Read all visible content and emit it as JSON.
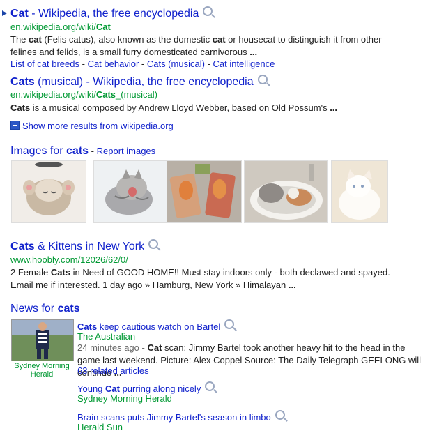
{
  "results": [
    {
      "title_pre": "Cat",
      "title_post": " - Wikipedia, the free encyclopedia",
      "url_pre": "en.wikipedia.org/wiki/",
      "url_bold": "Cat",
      "snippet_1": "The ",
      "snippet_b1": "cat",
      "snippet_2": " (Felis catus), also known as the domestic ",
      "snippet_b2": "cat",
      "snippet_3": " or housecat to distinguish it from other felines and felids, is a small furry domesticated carnivorous ",
      "snippet_b3": "...",
      "sitelinks": [
        "List of cat breeds",
        "Cat behavior",
        "Cats (musical)",
        "Cat intelligence"
      ]
    },
    {
      "title_pre": "Cats",
      "title_post": " (musical) - Wikipedia, the free encyclopedia",
      "url_pre": "en.wikipedia.org/wiki/",
      "url_bold": "Cats",
      "url_post": "_(musical)",
      "snippet_b1": "Cats",
      "snippet_2": " is a musical composed by Andrew Lloyd Webber, based on Old Possum's ",
      "snippet_b3": "..."
    }
  ],
  "show_more": "Show more results from wikipedia.org",
  "images": {
    "heading_pre": "Images for ",
    "heading_bold": "cats",
    "report_sep": " - ",
    "report": "Report images"
  },
  "hoobly": {
    "title_pre": "Cats",
    "title_post": " & Kittens in New York",
    "url": "www.hoobly.com/12026/62/0/",
    "snippet_1": "2 Female ",
    "snippet_b1": "Cats",
    "snippet_2": " in Need of GOOD HOME!! Must stay indoors only - both declawed and spayed. Email me if interested. 1 day ago » Hamburg, New York » Himalayan ",
    "snippet_b3": "..."
  },
  "news": {
    "heading_pre": "News for ",
    "heading_bold": "cats",
    "thumb_caption": "Sydney Morning Herald",
    "items": [
      {
        "title_b": "Cats",
        "title_post": " keep cautious watch on Bartel",
        "source": "The Australian",
        "meta": "24 minutes ago - ",
        "snip_b": "Cat",
        "snip": " scan: Jimmy Bartel took another heavy hit to the head in the game last weekend. Picture: Alex Coppel Source: The Daily Telegraph GEELONG will continue ",
        "snip_end": "...",
        "related": "63 related articles"
      },
      {
        "title_pre": "Young ",
        "title_b": "Cat",
        "title_post": " purring along nicely",
        "source": "Sydney Morning Herald"
      },
      {
        "title_post": "Brain scans puts Jimmy Bartel's season in limbo",
        "source": "Herald Sun"
      }
    ]
  }
}
